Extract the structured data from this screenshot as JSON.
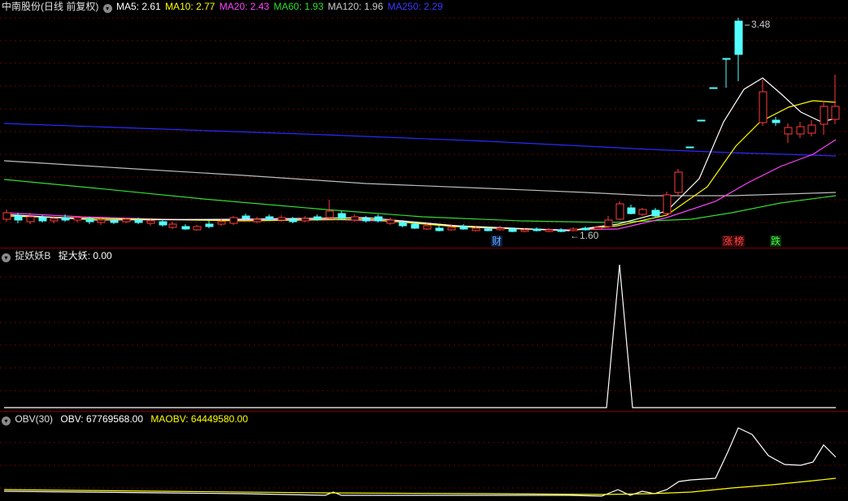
{
  "main_pane": {
    "title": "中南股份(日线 前复权)",
    "indicators": [
      {
        "label": "MA5: 2.61",
        "color": "#ffffff"
      },
      {
        "label": "MA10: 2.77",
        "color": "#ffff00"
      },
      {
        "label": "MA20: 2.43",
        "color": "#ff44ff"
      },
      {
        "label": "MA60: 1.93",
        "color": "#33dd33"
      },
      {
        "label": "MA120: 1.96",
        "color": "#cccccc"
      },
      {
        "label": "MA250: 2.29",
        "color": "#2a2aff"
      }
    ],
    "high_marker": "3.48",
    "low_marker": "←1.60",
    "event_tags": [
      {
        "text": "财",
        "color": "#66aaff"
      },
      {
        "text": "涨",
        "color": "#ff4444"
      },
      {
        "text": "榜",
        "color": "#ff4444"
      },
      {
        "text": "跌",
        "color": "#44ff44"
      }
    ]
  },
  "pane2": {
    "title": "捉妖妖B",
    "value_label": "捉大妖: 0.00",
    "signal": {
      "peak_bar": 254,
      "peak_value": 1,
      "base_value": 0
    }
  },
  "pane3": {
    "title": "OBV(30)",
    "obv_label": "OBV: 67769568.00",
    "maobv_label": "MAOBV: 64449580.00",
    "obv_color": "#ffffff",
    "maobv_color": "#ffff00"
  },
  "colors": {
    "up": "#ff3b3b",
    "down": "#54ffff",
    "grid": "#6e0000",
    "separator": "#7a0000"
  }
}
